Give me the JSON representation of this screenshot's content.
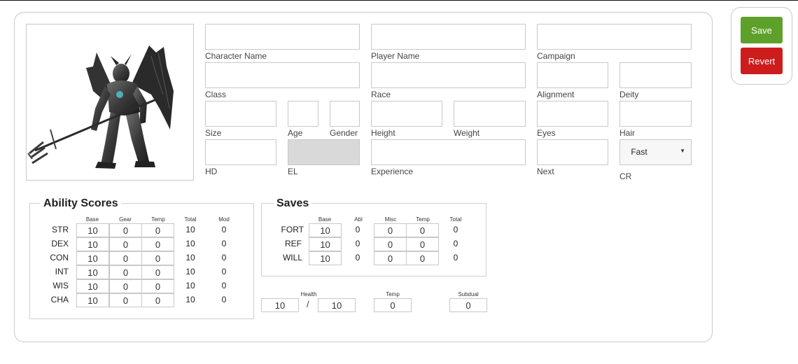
{
  "actions": {
    "save_label": "Save",
    "revert_label": "Revert"
  },
  "fields": {
    "character_name": {
      "label": "Character Name",
      "value": ""
    },
    "player_name": {
      "label": "Player Name",
      "value": ""
    },
    "campaign": {
      "label": "Campaign",
      "value": ""
    },
    "class": {
      "label": "Class",
      "value": ""
    },
    "race": {
      "label": "Race",
      "value": ""
    },
    "alignment": {
      "label": "Alignment",
      "value": ""
    },
    "deity": {
      "label": "Deity",
      "value": ""
    },
    "size": {
      "label": "Size",
      "value": ""
    },
    "age": {
      "label": "Age",
      "value": ""
    },
    "gender": {
      "label": "Gender",
      "value": ""
    },
    "height": {
      "label": "Height",
      "value": ""
    },
    "weight": {
      "label": "Weight",
      "value": ""
    },
    "eyes": {
      "label": "Eyes",
      "value": ""
    },
    "hair": {
      "label": "Hair",
      "value": ""
    },
    "hd": {
      "label": "HD",
      "value": ""
    },
    "el": {
      "label": "EL",
      "value": ""
    },
    "experience": {
      "label": "Experience",
      "value": ""
    },
    "next": {
      "label": "Next",
      "value": ""
    },
    "cr": {
      "label": "CR",
      "selected": "Fast"
    }
  },
  "abilities": {
    "title": "Ability Scores",
    "columns": [
      "Base",
      "Gear",
      "Temp",
      "Total",
      "Mod"
    ],
    "rows": [
      {
        "name": "STR",
        "base": "10",
        "gear": "0",
        "temp": "0",
        "total": "10",
        "mod": "0"
      },
      {
        "name": "DEX",
        "base": "10",
        "gear": "0",
        "temp": "0",
        "total": "10",
        "mod": "0"
      },
      {
        "name": "CON",
        "base": "10",
        "gear": "0",
        "temp": "0",
        "total": "10",
        "mod": "0"
      },
      {
        "name": "INT",
        "base": "10",
        "gear": "0",
        "temp": "0",
        "total": "10",
        "mod": "0"
      },
      {
        "name": "WIS",
        "base": "10",
        "gear": "0",
        "temp": "0",
        "total": "10",
        "mod": "0"
      },
      {
        "name": "CHA",
        "base": "10",
        "gear": "0",
        "temp": "0",
        "total": "10",
        "mod": "0"
      }
    ]
  },
  "saves": {
    "title": "Saves",
    "columns": [
      "Base",
      "Abl",
      "Misc",
      "Temp",
      "Total"
    ],
    "rows": [
      {
        "name": "FORT",
        "base": "10",
        "abl": "0",
        "misc": "0",
        "temp": "0",
        "total": "0"
      },
      {
        "name": "REF",
        "base": "10",
        "abl": "0",
        "misc": "0",
        "temp": "0",
        "total": "0"
      },
      {
        "name": "WILL",
        "base": "10",
        "abl": "0",
        "misc": "0",
        "temp": "0",
        "total": "0"
      }
    ]
  },
  "health": {
    "label": "Health",
    "current": "10",
    "separator": "/",
    "max": "10",
    "temp_label": "Temp",
    "temp": "0",
    "subdual_label": "Subdual",
    "subdual": "0"
  }
}
